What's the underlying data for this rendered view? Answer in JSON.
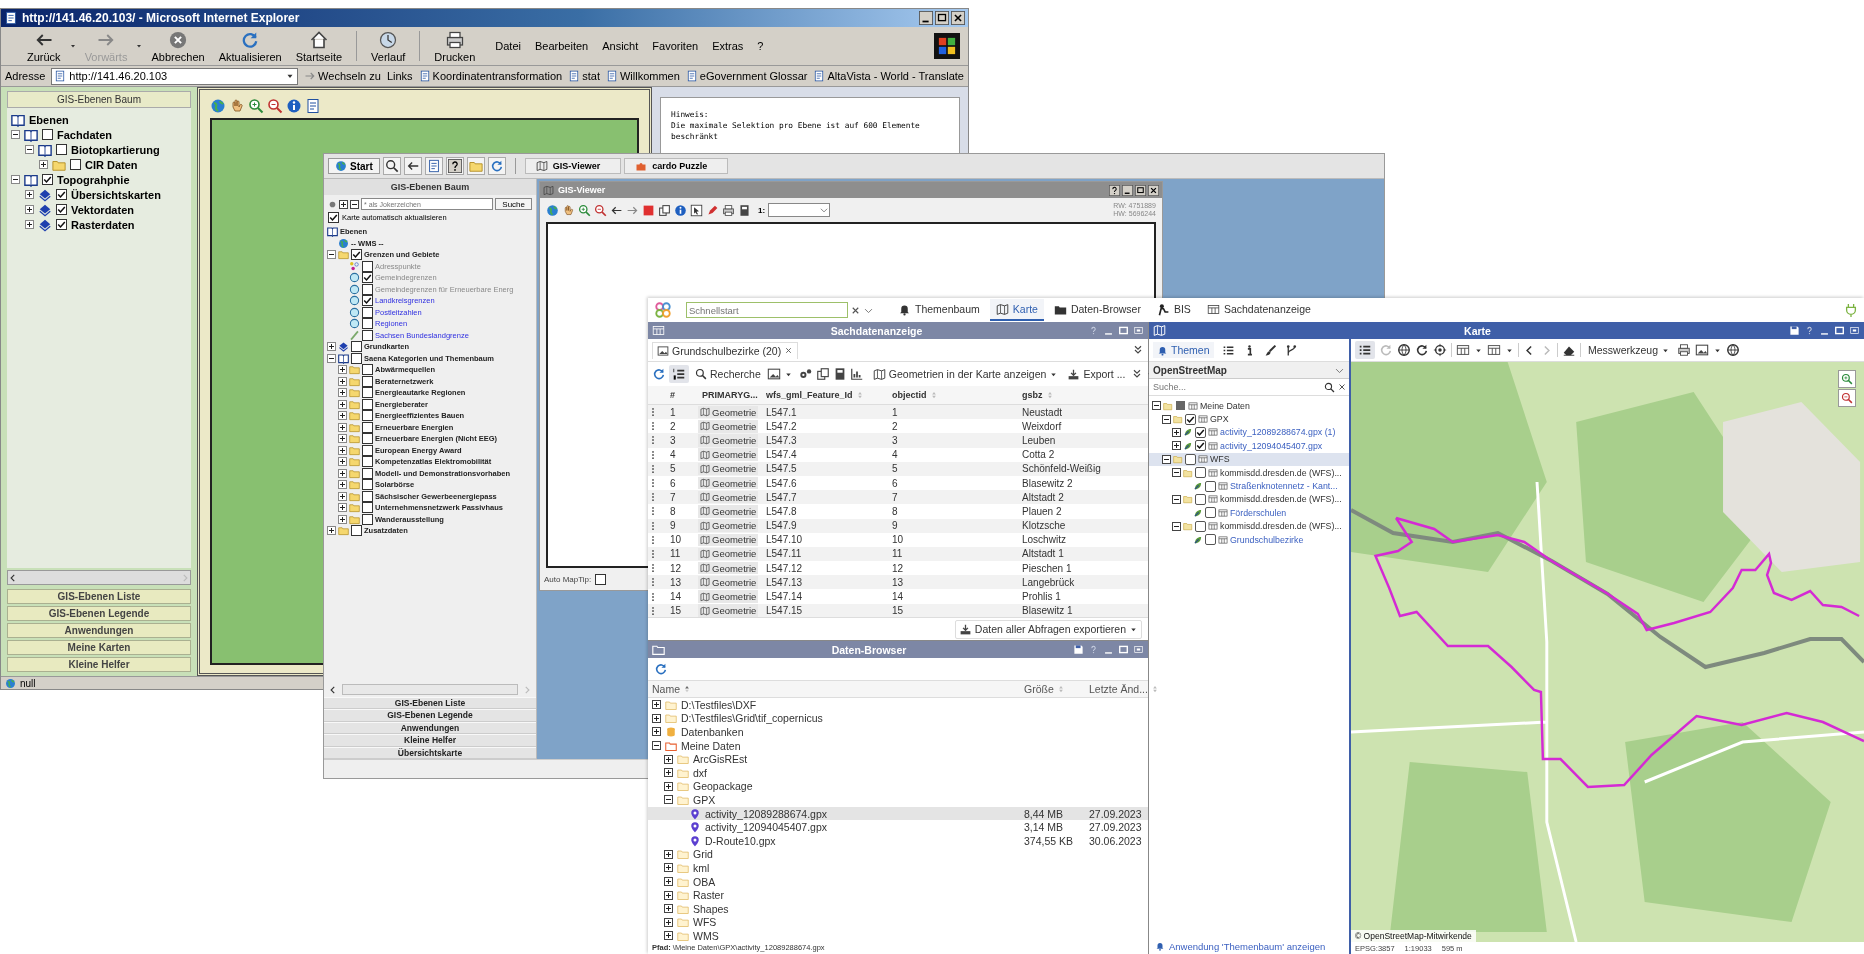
{
  "browser": {
    "title": "http://141.46.20.103/ - Microsoft Internet Explorer",
    "toolbar": [
      {
        "label": "Zurück",
        "disabled": false
      },
      {
        "label": "Vorwärts",
        "disabled": true
      },
      {
        "label": "Abbrechen",
        "disabled": false
      },
      {
        "label": "Aktualisieren",
        "disabled": false
      },
      {
        "label": "Startseite",
        "disabled": false
      },
      {
        "label": "Verlauf",
        "disabled": false
      },
      {
        "label": "Drucken",
        "disabled": false
      }
    ],
    "menu": [
      "Datei",
      "Bearbeiten",
      "Ansicht",
      "Favoriten",
      "Extras",
      "?"
    ],
    "address_label": "Adresse",
    "address": "http://141.46.20.103",
    "go": "Wechseln zu",
    "links_label": "Links",
    "links": [
      "Koordinatentransformation",
      "stat",
      "Willkommen",
      "eGovernment Glossar",
      "AltaVista - World - Translate"
    ],
    "panel_title": "GIS-Ebenen Baum",
    "tree_root": "Ebenen",
    "tree": [
      {
        "label": "Fachdaten",
        "kind": "book",
        "expanded": true,
        "checked": false,
        "children": [
          {
            "label": "Biotopkartierung",
            "kind": "book",
            "expanded": true,
            "checked": false,
            "children": [
              {
                "label": "CIR Daten",
                "kind": "folder",
                "expanded": false,
                "checked": false
              }
            ]
          }
        ]
      },
      {
        "label": "Topograhphie",
        "kind": "book",
        "expanded": true,
        "checked": true,
        "children": [
          {
            "label": "Übersichtskarten",
            "kind": "diamond",
            "expanded": false,
            "checked": true
          },
          {
            "label": "Vektordaten",
            "kind": "diamond",
            "expanded": false,
            "checked": true
          },
          {
            "label": "Rasterdaten",
            "kind": "diamond",
            "expanded": false,
            "checked": true
          }
        ]
      }
    ],
    "panel_buttons": [
      "GIS-Ebenen Liste",
      "GIS-Ebenen Legende",
      "Anwendungen",
      "Meine Karten",
      "Kleine Helfer"
    ],
    "notice_title": "Hinweis:",
    "notice": "Die maximale Selektion pro Ebene ist auf 600 Elemente beschränkt",
    "status": "null"
  },
  "gis": {
    "start": "Start",
    "tasks": [
      "GIS-Viewer",
      "cardo Puzzle"
    ],
    "panel_title": "GIS-Ebenen Baum",
    "search_placeholder": "* als Jokerzeichen",
    "search_button": "Suche",
    "auto_update": {
      "label": "Karte automatisch aktualisieren",
      "checked": true
    },
    "tree_root": "Ebenen",
    "tree": [
      {
        "label": "-- WMS --",
        "kind": "globe"
      },
      {
        "label": "Grenzen und Gebiete",
        "kind": "folder",
        "expanded": true,
        "checked": true,
        "children": [
          {
            "label": "Adresspunkte",
            "kind": "points",
            "checked": false,
            "disabled": true
          },
          {
            "label": "Gemeindegrenzen",
            "kind": "circle",
            "checked": true,
            "disabled": true
          },
          {
            "label": "Gemeindegrenzen für Erneuerbare Energ",
            "kind": "circle",
            "checked": false,
            "disabled": true
          },
          {
            "label": "Landkreisgrenzen",
            "kind": "circle",
            "checked": true,
            "disabled": false
          },
          {
            "label": "Postleitzahlen",
            "kind": "circle",
            "checked": false,
            "disabled": false
          },
          {
            "label": "Regionen",
            "kind": "circle",
            "checked": false,
            "disabled": false
          },
          {
            "label": "Sachsen Bundeslandgrenze",
            "kind": "line",
            "checked": false,
            "disabled": false
          }
        ]
      },
      {
        "label": "Grundkarten",
        "kind": "diamond",
        "expanded": false,
        "checked": false
      },
      {
        "label": "Saena Kategorien und Themenbaum",
        "kind": "book",
        "expanded": true,
        "checked": false,
        "children": [
          {
            "label": "Abwärmequellen",
            "kind": "folder",
            "expanded": false,
            "checked": false
          },
          {
            "label": "Beraternetzwerk",
            "kind": "folder",
            "expanded": false,
            "checked": false
          },
          {
            "label": "Energieautarke Regionen",
            "kind": "folder",
            "expanded": false,
            "checked": false
          },
          {
            "label": "Energieberater",
            "kind": "folder",
            "expanded": false,
            "checked": false
          },
          {
            "label": "Energieeffizientes Bauen",
            "kind": "folder",
            "expanded": false,
            "checked": false
          },
          {
            "label": "Erneuerbare Energien",
            "kind": "folder",
            "expanded": false,
            "checked": false
          },
          {
            "label": "Erneuerbare Energien (Nicht EEG)",
            "kind": "folder",
            "expanded": false,
            "checked": false
          },
          {
            "label": "European Energy Award",
            "kind": "folder",
            "expanded": false,
            "checked": false
          },
          {
            "label": "Kompetenzatlas Elektromobilität",
            "kind": "folder",
            "expanded": false,
            "checked": false
          },
          {
            "label": "Modell- und Demonstrationsvorhaben",
            "kind": "folder",
            "expanded": false,
            "checked": false
          },
          {
            "label": "Solarbörse",
            "kind": "folder",
            "expanded": false,
            "checked": false
          },
          {
            "label": "Sächsischer Gewerbeenergiepass",
            "kind": "folder",
            "expanded": false,
            "checked": false
          },
          {
            "label": "Unternehmensnetzwerk Passivhaus",
            "kind": "folder",
            "expanded": false,
            "checked": false
          },
          {
            "label": "Wanderausstellung",
            "kind": "folder",
            "expanded": false,
            "checked": false
          }
        ]
      },
      {
        "label": "Zusatzdaten",
        "kind": "folder",
        "expanded": false,
        "checked": false
      }
    ],
    "panel_buttons": [
      "GIS-Ebenen Liste",
      "GIS-Ebenen Legende",
      "Anwendungen",
      "Kleine Helfer",
      "Übersichtskarte"
    ],
    "viewer": {
      "title": "GIS-Viewer",
      "scale_label": "1:",
      "coords": [
        "RW: 4751889",
        "HW: 5696244"
      ],
      "maptip": {
        "label": "Auto MapTip:",
        "checked": false
      }
    }
  },
  "cardo": {
    "search_placeholder": "Schnellstart",
    "nav": [
      {
        "label": "Themenbaum",
        "selected": false
      },
      {
        "label": "Karte",
        "selected": true
      },
      {
        "label": "Daten-Browser",
        "selected": false
      },
      {
        "label": "BIS",
        "selected": false
      },
      {
        "label": "Sachdatenanzeige",
        "selected": false
      }
    ],
    "table_panel": {
      "title": "Sachdatenanzeige",
      "tab": "Grundschulbezirke (20)",
      "search_button": "Recherche",
      "show_button": "Geometrien in der Karte anzeigen",
      "export_button": "Export ...",
      "columns": [
        "#",
        "PRIMARYG...",
        "wfs_gml_Feature_Id",
        "objectid",
        "gsbz"
      ],
      "rows": [
        {
          "num": "1",
          "geometry": "Geometrie",
          "feature_id": "L547.1",
          "objectid": "1",
          "gsbz": "Neustadt"
        },
        {
          "num": "2",
          "geometry": "Geometrie",
          "feature_id": "L547.2",
          "objectid": "2",
          "gsbz": "Weixdorf"
        },
        {
          "num": "3",
          "geometry": "Geometrie",
          "feature_id": "L547.3",
          "objectid": "3",
          "gsbz": "Leuben"
        },
        {
          "num": "4",
          "geometry": "Geometrie",
          "feature_id": "L547.4",
          "objectid": "4",
          "gsbz": "Cotta 2"
        },
        {
          "num": "5",
          "geometry": "Geometrie",
          "feature_id": "L547.5",
          "objectid": "5",
          "gsbz": "Schönfeld-Weißig"
        },
        {
          "num": "6",
          "geometry": "Geometrie",
          "feature_id": "L547.6",
          "objectid": "6",
          "gsbz": "Blasewitz 2"
        },
        {
          "num": "7",
          "geometry": "Geometrie",
          "feature_id": "L547.7",
          "objectid": "7",
          "gsbz": "Altstadt 2"
        },
        {
          "num": "8",
          "geometry": "Geometrie",
          "feature_id": "L547.8",
          "objectid": "8",
          "gsbz": "Plauen 2"
        },
        {
          "num": "9",
          "geometry": "Geometrie",
          "feature_id": "L547.9",
          "objectid": "9",
          "gsbz": "Klotzsche"
        },
        {
          "num": "10",
          "geometry": "Geometrie",
          "feature_id": "L547.10",
          "objectid": "10",
          "gsbz": "Loschwitz"
        },
        {
          "num": "11",
          "geometry": "Geometrie",
          "feature_id": "L547.11",
          "objectid": "11",
          "gsbz": "Altstadt 1"
        },
        {
          "num": "12",
          "geometry": "Geometrie",
          "feature_id": "L547.12",
          "objectid": "12",
          "gsbz": "Pieschen 1"
        },
        {
          "num": "13",
          "geometry": "Geometrie",
          "feature_id": "L547.13",
          "objectid": "13",
          "gsbz": "Langebrück"
        },
        {
          "num": "14",
          "geometry": "Geometrie",
          "feature_id": "L547.14",
          "objectid": "14",
          "gsbz": "Prohlis 1"
        },
        {
          "num": "15",
          "geometry": "Geometrie",
          "feature_id": "L547.15",
          "objectid": "15",
          "gsbz": "Blasewitz 1"
        }
      ],
      "export_all": "Daten aller Abfragen exportieren"
    },
    "browser_panel": {
      "title": "Daten-Browser",
      "columns": [
        "Name",
        "Größe",
        "Letzte Änd..."
      ],
      "items": [
        {
          "name": "D:\\Testfiles\\DXF",
          "kind": "drive",
          "expanded": false,
          "selected": false
        },
        {
          "name": "D:\\Testfiles\\Grid\\tif_copernicus",
          "kind": "drive",
          "expanded": false,
          "selected": false
        },
        {
          "name": "Datenbanken",
          "kind": "database",
          "expanded": false,
          "selected": false
        },
        {
          "name": "Meine Daten",
          "kind": "home",
          "expanded": true,
          "selected": false,
          "children": [
            {
              "name": "ArcGisREst",
              "kind": "folder",
              "expanded": false,
              "selected": false
            },
            {
              "name": "dxf",
              "kind": "folder",
              "expanded": false,
              "selected": false
            },
            {
              "name": "Geopackage",
              "kind": "folder",
              "expanded": false,
              "selected": false
            },
            {
              "name": "GPX",
              "kind": "folder",
              "expanded": true,
              "selected": false,
              "children": [
                {
                  "name": "activity_12089288674.gpx",
                  "kind": "file",
                  "size": "8,44 MB",
                  "date": "27.09.2023",
                  "selected": true
                },
                {
                  "name": "activity_12094045407.gpx",
                  "kind": "file",
                  "size": "3,14 MB",
                  "date": "27.09.2023",
                  "selected": false
                },
                {
                  "name": "D-Route10.gpx",
                  "kind": "file",
                  "size": "374,55 KB",
                  "date": "30.06.2023",
                  "selected": false
                }
              ]
            },
            {
              "name": "Grid",
              "kind": "folder",
              "expanded": false,
              "selected": false
            },
            {
              "name": "kml",
              "kind": "folder",
              "expanded": false,
              "selected": false
            },
            {
              "name": "OBA",
              "kind": "folder",
              "expanded": false,
              "selected": false
            },
            {
              "name": "Raster",
              "kind": "folder",
              "expanded": false,
              "selected": false
            },
            {
              "name": "Shapes",
              "kind": "folder",
              "expanded": false,
              "selected": false
            },
            {
              "name": "WFS",
              "kind": "folder",
              "expanded": false,
              "selected": false
            },
            {
              "name": "WMS",
              "kind": "folder",
              "expanded": false,
              "selected": false
            }
          ]
        }
      ],
      "path": "**Pfad:** \\Meine Daten\\GPX\\activity_12089288674.gpx"
    },
    "map_panel": {
      "title": "Karte",
      "side_tab": "Themen",
      "basemap": "OpenStreetMap",
      "search_placeholder": "Suche...",
      "tree": [
        {
          "label": "Meine Daten",
          "kind": "folder",
          "expanded": true,
          "partial": true,
          "selected": false,
          "children": [
            {
              "label": "GPX",
              "kind": "folder",
              "expanded": true,
              "checked": true,
              "partial": false,
              "selected": false,
              "children": [
                {
                  "label": "activity_12089288674.gpx (1)",
                  "kind": "layer",
                  "expanded": false,
                  "checked": true,
                  "partial": false,
                  "selected": false
                },
                {
                  "label": "activity_12094045407.gpx",
                  "kind": "layer",
                  "expanded": false,
                  "checked": true,
                  "partial": false,
                  "selected": false
                }
              ]
            },
            {
              "label": "WFS",
              "kind": "folder",
              "expanded": true,
              "checked": false,
              "partial": false,
              "selected": true,
              "children": [
                {
                  "label": "kommisdd.dresden.de (WFS)...",
                  "kind": "folder",
                  "expanded": true,
                  "checked": false,
                  "partial": false,
                  "selected": false,
                  "children": [
                    {
                      "label": "Straßenknotennetz - Kant...",
                      "kind": "layer",
                      "checked": false,
                      "partial": false,
                      "selected": false
                    }
                  ]
                },
                {
                  "label": "kommisdd.dresden.de (WFS)...",
                  "kind": "folder",
                  "expanded": true,
                  "checked": false,
                  "partial": false,
                  "selected": false,
                  "children": [
                    {
                      "label": "Förderschulen",
                      "kind": "layer",
                      "checked": false,
                      "partial": false,
                      "selected": false
                    }
                  ]
                },
                {
                  "label": "kommisdd.dresden.de (WFS)...",
                  "kind": "folder",
                  "expanded": true,
                  "checked": false,
                  "partial": false,
                  "selected": false,
                  "children": [
                    {
                      "label": "Grundschulbezirke",
                      "kind": "layer",
                      "checked": false,
                      "partial": false,
                      "selected": false
                    }
                  ]
                }
              ]
            }
          ]
        }
      ],
      "footer": "Anwendung 'Themenbaum' anzeigen",
      "measure": "Messwerkzeug",
      "attribution": "© OpenStreetMap-Mitwirkende",
      "status": [
        "EPSG:3857",
        "1:19033",
        "595 m"
      ]
    }
  }
}
